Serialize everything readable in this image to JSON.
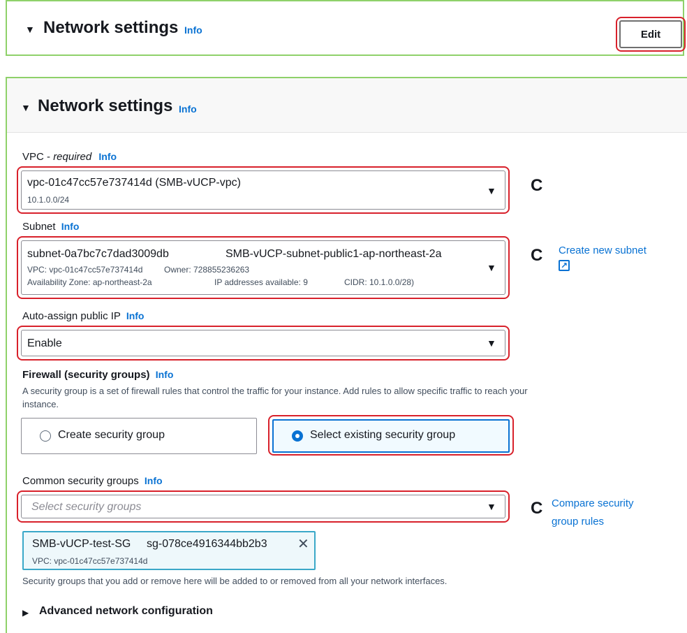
{
  "top_panel": {
    "title": "Network settings",
    "info": "Info",
    "edit_label": "Edit"
  },
  "main_panel": {
    "title": "Network settings",
    "info": "Info"
  },
  "vpc": {
    "label": "VPC",
    "label_suffix": " - ",
    "required": "required",
    "info": "Info",
    "value": "vpc-01c47cc57e737414d (SMB-vUCP-vpc)",
    "sub": "10.1.0.0/24"
  },
  "subnet": {
    "label": "Subnet",
    "info": "Info",
    "id": "subnet-0a7bc7c7dad3009db",
    "name": "SMB-vUCP-subnet-public1-ap-northeast-2a",
    "vpc": "VPC: vpc-01c47cc57e737414d",
    "owner": "Owner: 728855236263",
    "az": "Availability Zone: ap-northeast-2a",
    "ips": "IP addresses available: 9",
    "cidr": "CIDR: 10.1.0.0/28)",
    "create_link": "Create new subnet"
  },
  "public_ip": {
    "label": "Auto-assign public IP",
    "info": "Info",
    "value": "Enable"
  },
  "firewall": {
    "label": "Firewall (security groups)",
    "info": "Info",
    "desc1": "A security group is a set of firewall rules that control the traffic for your instance. Add rules to allow specific traffic to reach your",
    "desc2": "instance.",
    "option_create": "Create security group",
    "option_select": "Select existing security group"
  },
  "common_sg": {
    "label": "Common security groups",
    "info": "Info",
    "placeholder": "Select security groups",
    "compare_link_1": "Compare security",
    "compare_link_2": "group rules",
    "token_name": "SMB-vUCP-test-SG",
    "token_id": "sg-078ce4916344bb2b3",
    "token_vpc": "VPC: vpc-01c47cc57e737414d",
    "note": "Security groups that you add or remove here will be added to or removed from all your network interfaces."
  },
  "advanced": {
    "label": "Advanced network configuration"
  },
  "icons": {
    "caret_down": "▼",
    "caret_right": "▶",
    "refresh": "C",
    "external": "↗",
    "close": "✕"
  }
}
